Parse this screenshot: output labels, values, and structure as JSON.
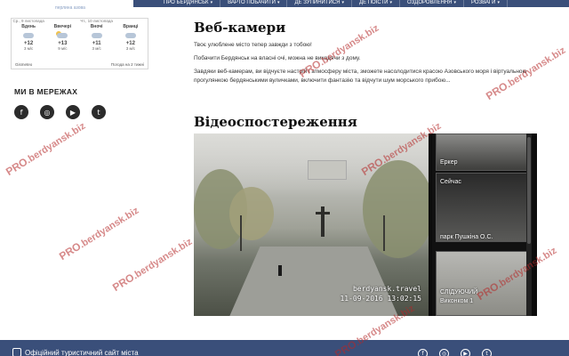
{
  "logo": {
    "subtitle": "перлина азова"
  },
  "nav": {
    "items": [
      {
        "label": "ПРО БЕРДЯНСЬК",
        "chevron": "▾"
      },
      {
        "label": "ВАРТО ПОБАЧИТИ",
        "chevron": "▾"
      },
      {
        "label": "ДЕ ЗУПИНИТИСЯ",
        "chevron": "▾"
      },
      {
        "label": "ДЕ ПОЇСТИ",
        "chevron": "▾"
      },
      {
        "label": "ОЗДОРОВЛЕННЯ",
        "chevron": "▾"
      },
      {
        "label": "РОЗВАГИ",
        "chevron": "▾"
      }
    ]
  },
  "weather": {
    "days": [
      {
        "date": "Ср., 9 листопада",
        "name": "Вдень",
        "temp": "+12",
        "wind": "3 м/с"
      },
      {
        "date": "",
        "name": "Ввечері",
        "temp": "+13",
        "wind": "9 м/с"
      },
      {
        "date": "Чт., 10 листопада",
        "name": "Вночі",
        "temp": "+11",
        "wind": "3 м/с"
      },
      {
        "date": "",
        "name": "Вранці",
        "temp": "+12",
        "wind": "3 м/с"
      }
    ],
    "source": "Gismeteo",
    "forecast_link": "Погода на 2 тижні"
  },
  "social": {
    "title": "МИ В МЕРЕЖАХ",
    "icons": [
      "f",
      "◎",
      "▶",
      "t"
    ]
  },
  "main": {
    "heading": "Веб-камери",
    "p1": "Твоє улюблене місто тепер завжди з тобою!",
    "p2": "Побачити Бердянськ на власні очі, можна не виходячи з дому.",
    "p3": "Завдяки веб-камерам, ви відчуєте настрій і атмосферу міста, зможете насолодитися красою Азовського моря і віртуальною прогулянкою бердянськими вуличками, включити фантазію та відчути шум морського прибою...",
    "video_heading": "Відеоспостереження"
  },
  "video": {
    "overlay_site": "berdyansk.travel",
    "overlay_time": "11-09-2016 13:02:15",
    "cameras": [
      {
        "label": "Еркер"
      },
      {
        "label": "Сейчас"
      },
      {
        "label": "парк Пушкіна О.С."
      },
      {
        "label": "СЛІДУЮЧИЙ"
      },
      {
        "label": "Виконком 1"
      }
    ]
  },
  "footer": {
    "text": "Офіційний туристичний сайт міста",
    "icons": [
      "f",
      "◎",
      "▶",
      "t"
    ]
  },
  "watermark": {
    "prefix": "PRO",
    "text": ".berdyansk.biz"
  }
}
